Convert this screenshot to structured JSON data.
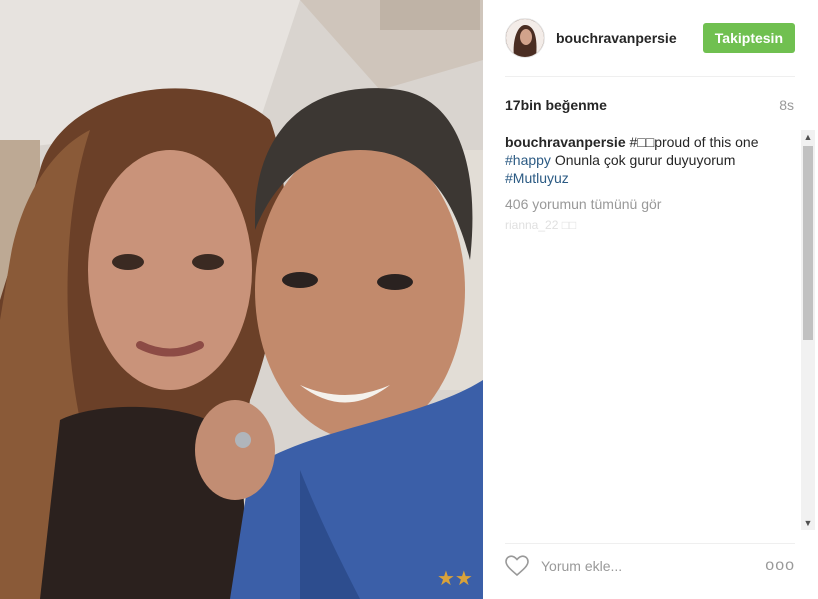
{
  "post": {
    "username": "bouchravanpersie",
    "follow_label": "Takiptesin",
    "likes": "17bin beğenme",
    "time": "8s"
  },
  "caption": {
    "username": "bouchravanpersie",
    "text_part1": " #□□proud of this one ",
    "hashtag1": "#happy",
    "text_part2": " Onunla çok gurur duyuyorum ",
    "hashtag2": "#Mutluyuz"
  },
  "comments": {
    "view_all": "406 yorumun tümünü gör",
    "partial_top": "rianna_22 □□"
  },
  "comment_bar": {
    "placeholder": "Yorum ekle...",
    "more": "ooo"
  },
  "icons": {
    "heart": "heart-outline-icon",
    "more": "more-options-icon"
  },
  "colors": {
    "follow_button": "#70c050",
    "hashtag": "#2b5a83"
  }
}
